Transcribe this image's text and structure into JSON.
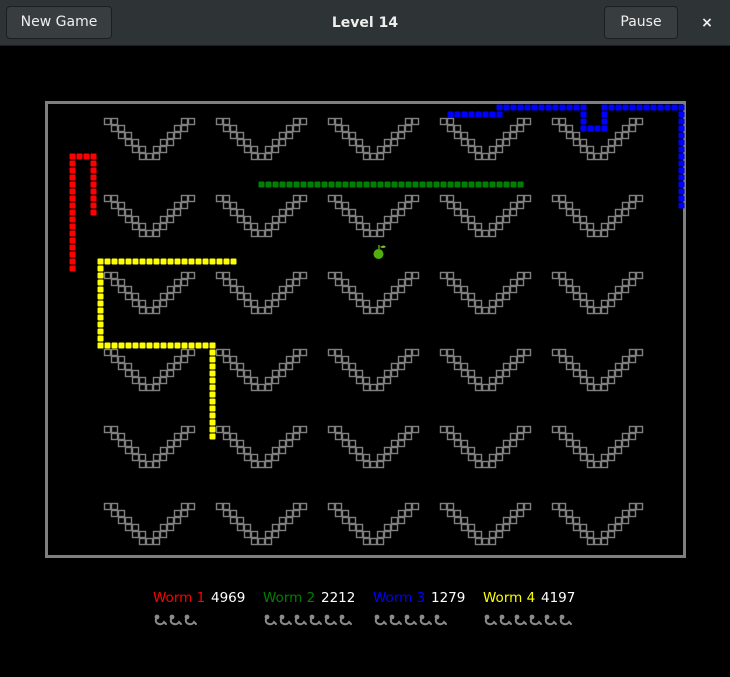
{
  "header": {
    "new_game_label": "New Game",
    "title": "Level 14",
    "pause_label": "Pause",
    "close_glyph": "×"
  },
  "colors": {
    "wall": "#7f7f7f",
    "worm1": "#ff0000",
    "worm2": "#008000",
    "worm3": "#0000ff",
    "worm4": "#ffff00",
    "apple": "#52ad0f",
    "background": "#000000",
    "headerbar": "#2e3336"
  },
  "arena": {
    "grid_cols": 92,
    "grid_rows": 66,
    "v_obstacle_rows": 6,
    "v_obstacle_cols": 5
  },
  "worms": [
    {
      "name": "Worm 1",
      "score": "4969",
      "lives": 3,
      "color": "#ff0000"
    },
    {
      "name": "Worm 2",
      "score": "2212",
      "lives": 6,
      "color": "#008000"
    },
    {
      "name": "Worm 3",
      "score": "1279",
      "lives": 5,
      "color": "#0000ff"
    },
    {
      "name": "Worm 4",
      "score": "4197",
      "lives": 6,
      "color": "#ffff00"
    }
  ]
}
